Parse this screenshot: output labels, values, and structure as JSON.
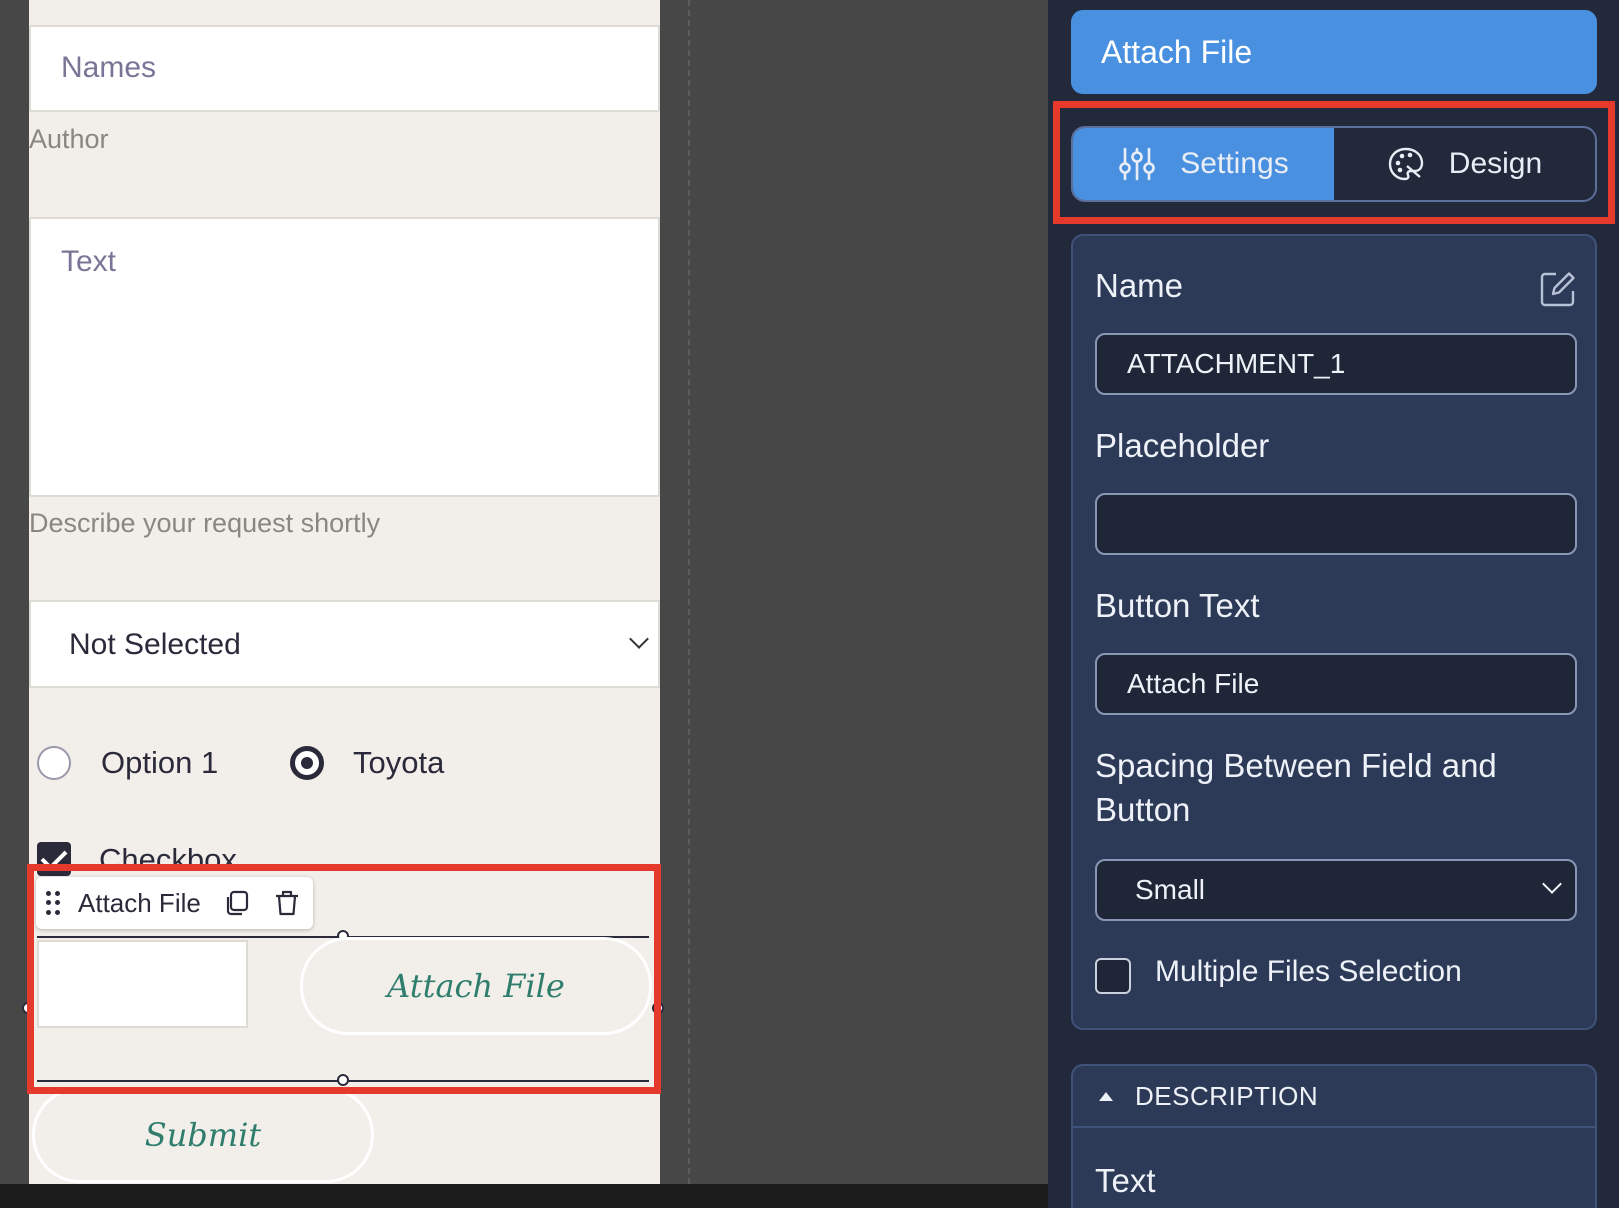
{
  "form": {
    "names_placeholder": "Names",
    "author_help": "Author",
    "text_placeholder": "Text",
    "text_help": "Describe your request shortly",
    "select_value": "Not Selected",
    "radio_options": [
      {
        "label": "Option 1",
        "selected": false
      },
      {
        "label": "Toyota",
        "selected": true
      }
    ],
    "checkbox_label": "Checkbox",
    "attach_button_label": "Attach File",
    "submit_label": "Submit"
  },
  "element_toolbar": {
    "label": "Attach File",
    "icons": [
      "drag-handle-icon",
      "duplicate-icon",
      "trash-icon"
    ]
  },
  "panel": {
    "header_title": "Attach File",
    "tabs": [
      {
        "label": "Settings",
        "icon": "sliders-icon",
        "active": true
      },
      {
        "label": "Design",
        "icon": "palette-icon",
        "active": false
      }
    ],
    "fields": {
      "name_label": "Name",
      "name_value": "ATTACHMENT_1",
      "placeholder_label": "Placeholder",
      "placeholder_value": "",
      "button_text_label": "Button Text",
      "button_text_value": "Attach File",
      "spacing_label": "Spacing Between Field and Button",
      "spacing_value": "Small",
      "multiple_files_label": "Multiple Files Selection",
      "multiple_files_checked": false
    },
    "description": {
      "heading": "DESCRIPTION",
      "text_label": "Text"
    }
  },
  "colors": {
    "accent": "#4a90e0",
    "highlight": "#e5392b",
    "panel_bg": "#22293a",
    "card_bg": "#2c3a57",
    "form_bg": "#f2efea",
    "button_text": "#2e7d6d"
  }
}
